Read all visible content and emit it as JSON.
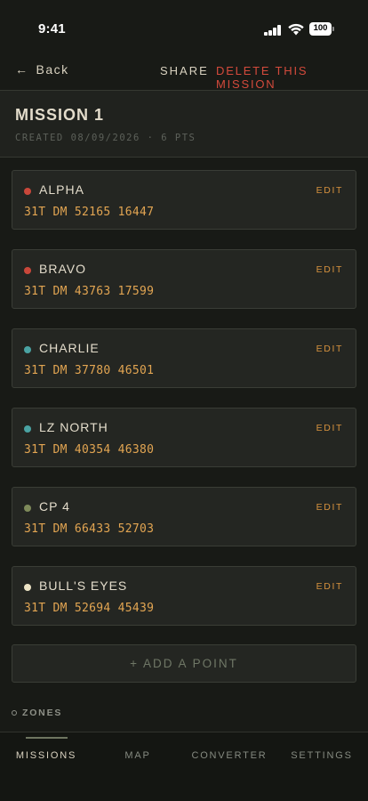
{
  "status_bar": {
    "time": "9:41",
    "battery": "100"
  },
  "nav": {
    "back_label": "Back",
    "share_label": "SHARE",
    "delete_label": "DELETE THIS MISSION"
  },
  "mission": {
    "title": "MISSION 1",
    "meta": "CREATED 08/09/2026 · 6 PTS"
  },
  "points": [
    {
      "name": "ALPHA",
      "coord": "31T DM 52165 16447",
      "dot_color": "#c9473a",
      "edit_label": "EDIT"
    },
    {
      "name": "BRAVO",
      "coord": "31T DM 43763 17599",
      "dot_color": "#c9473a",
      "edit_label": "EDIT"
    },
    {
      "name": "CHARLIE",
      "coord": "31T DM 37780 46501",
      "dot_color": "#4aa3a3",
      "edit_label": "EDIT"
    },
    {
      "name": "LZ NORTH",
      "coord": "31T DM 40354 46380",
      "dot_color": "#4aa3a3",
      "edit_label": "EDIT"
    },
    {
      "name": "CP 4",
      "coord": "31T DM 66433 52703",
      "dot_color": "#7e8a5a",
      "edit_label": "EDIT"
    },
    {
      "name": "BULL'S EYES",
      "coord": "31T DM 52694 45439",
      "dot_color": "#ece3c5",
      "edit_label": "EDIT"
    }
  ],
  "add_point_label": "+ ADD A POINT",
  "zones_label": "ZONES",
  "tabs": [
    {
      "label": "MISSIONS",
      "active": true
    },
    {
      "label": "MAP",
      "active": false
    },
    {
      "label": "CONVERTER",
      "active": false
    },
    {
      "label": "SETTINGS",
      "active": false
    }
  ],
  "colors": {
    "accent_orange": "#e2a552",
    "danger_red": "#d44a3c",
    "background": "#181a16"
  }
}
